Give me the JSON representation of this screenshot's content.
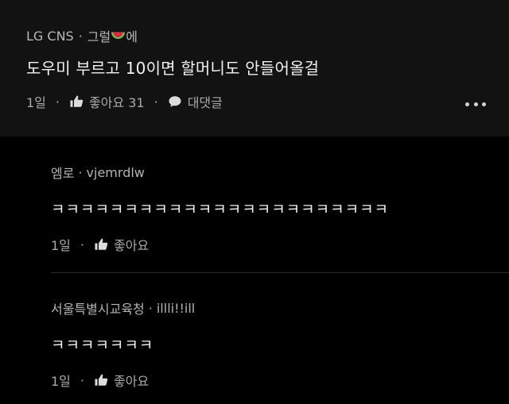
{
  "post": {
    "company": "LG CNS",
    "separator": "·",
    "author_part1": "그럴",
    "author_icon": "watermelon-emoji",
    "author_part2": "에",
    "title": "도우미 부르고 10이면 할머니도 안들어올걸",
    "time": "1일",
    "like_label": "좋아요 31",
    "comment_label": "대댓글",
    "dot": "·"
  },
  "replies": [
    {
      "name": "엠로",
      "sep": "·",
      "handle": "vjemrdlw",
      "body": "ㅋㅋㅋㅋㅋㅋㅋㅋㅋㅋㅋㅋㅋㅋㅋㅋㅋㅋㅋㅋㅋㅋㅋ",
      "time": "1일",
      "dot": "·",
      "like_label": "좋아요"
    },
    {
      "name": "서울특별시교육청",
      "sep": "·",
      "handle": "illli!!ill",
      "body": "ㅋㅋㅋㅋㅋㅋㅋ",
      "time": "1일",
      "dot": "·",
      "like_label": "좋아요"
    }
  ],
  "colors": {
    "background": "#000000",
    "post_background": "#121212",
    "text_primary": "#f2f2f2",
    "text_secondary": "#a9a9a9"
  }
}
